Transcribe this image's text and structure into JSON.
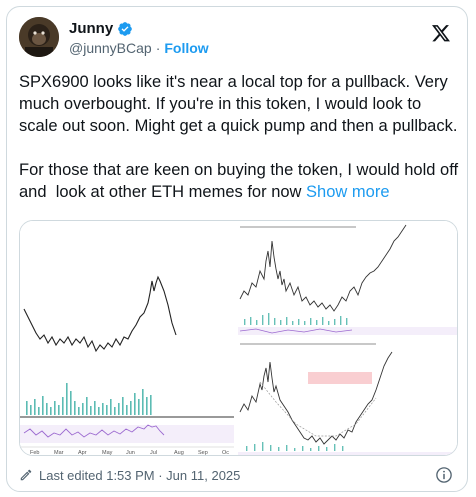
{
  "author": {
    "display_name": "Junny",
    "handle": "@junnyBCap",
    "separator": "·",
    "follow_label": "Follow"
  },
  "tweet": {
    "text": "SPX6900 looks like it's near a local top for a pullback. Very much overbought. If you're in this token, I would look to scale out soon. Might get a quick pump and then a pullback.\n\nFor those that are keen on buying the token, I would hold off and  look at other ETH memes for now ",
    "show_more_label": "Show more"
  },
  "media": {
    "left_chart_months": [
      "Feb",
      "Mar",
      "Apr",
      "May",
      "Jun",
      "Jul",
      "Aug",
      "Sep",
      "Oc"
    ]
  },
  "footer": {
    "edited_label": "Last edited 1:53 PM · Jun 11, 2025"
  },
  "colors": {
    "accent": "#1d9bf0",
    "text": "#0f1419",
    "muted": "#536471"
  },
  "icons": [
    "verified-badge-icon",
    "x-logo-icon",
    "pencil-icon",
    "info-icon"
  ]
}
